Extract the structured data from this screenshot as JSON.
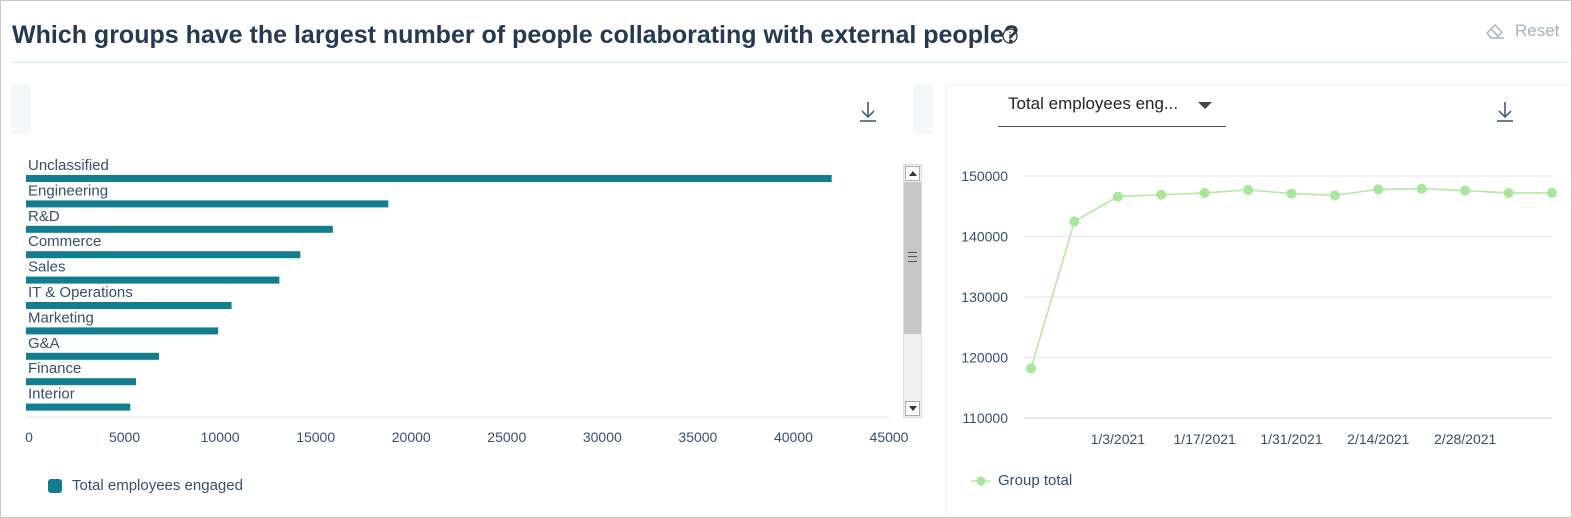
{
  "header": {
    "title": "Which groups have the largest number of people collaborating with external people?",
    "info_icon": "info-icon",
    "reset_label": "Reset",
    "reset_icon": "eraser-icon"
  },
  "right_panel": {
    "dropdown_value": "Total employees eng..."
  },
  "colors": {
    "bar": "#127d8e",
    "line": "#b4eaa6",
    "marker": "#a8e69a",
    "title": "#243a52",
    "axis_text": "#355070"
  },
  "chart_data": [
    {
      "type": "bar",
      "orientation": "horizontal",
      "categories": [
        "Unclassified",
        "Engineering",
        "R&D",
        "Commerce",
        "Sales",
        "IT & Operations",
        "Marketing",
        "G&A",
        "Finance",
        "Interior"
      ],
      "series": [
        {
          "name": "Total employees engaged",
          "values": [
            42000,
            18800,
            15900,
            14200,
            13100,
            10600,
            9900,
            6800,
            5600,
            5300
          ]
        }
      ],
      "xlim": [
        0,
        45000
      ],
      "xticks": [
        "0",
        "5000",
        "10000",
        "15000",
        "20000",
        "25000",
        "30000",
        "35000",
        "40000",
        "45000"
      ],
      "legend": "bottom-left",
      "grid": false
    },
    {
      "type": "line",
      "x": [
        "12/20/2020",
        "12/27/2020",
        "1/3/2021",
        "1/10/2021",
        "1/17/2021",
        "1/24/2021",
        "1/31/2021",
        "2/7/2021",
        "2/14/2021",
        "2/21/2021",
        "2/28/2021",
        "3/7/2021",
        "3/14/2021"
      ],
      "series": [
        {
          "name": "Group total",
          "values": [
            118200,
            142500,
            146600,
            146900,
            147200,
            147700,
            147100,
            146800,
            147800,
            147900,
            147600,
            147200,
            147200
          ]
        }
      ],
      "xticks": [
        "1/3/2021",
        "1/17/2021",
        "1/31/2021",
        "2/14/2021",
        "2/28/2021"
      ],
      "yticks": [
        "110000",
        "120000",
        "130000",
        "140000",
        "150000"
      ],
      "ylim": [
        110000,
        150000
      ],
      "legend": "bottom-left",
      "grid": true
    }
  ]
}
